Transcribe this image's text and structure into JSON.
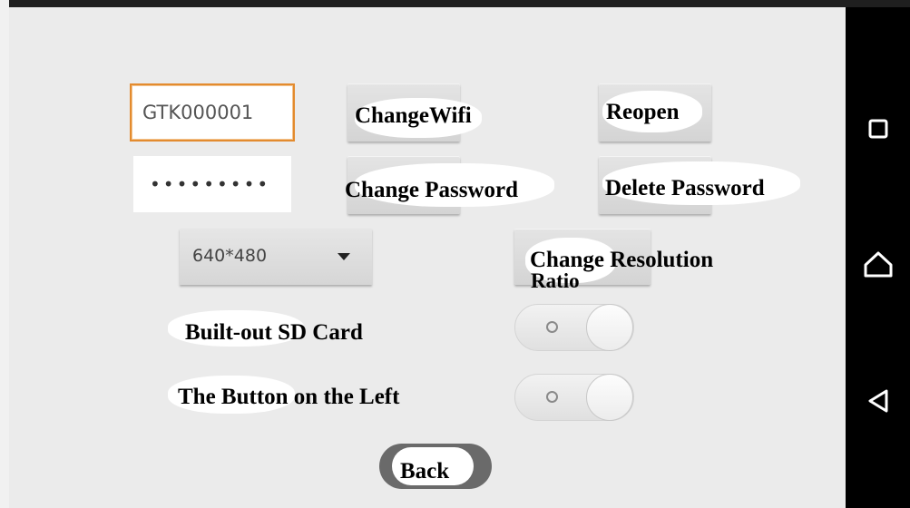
{
  "wifi": {
    "ssid_value": "GTK000001",
    "password_value": "•••••••••",
    "change_wifi_label": "ChangeWifi",
    "reopen_label": "Reopen",
    "change_password_label": "Change Password",
    "delete_password_label": "Delete Password"
  },
  "resolution": {
    "selected": "640*480",
    "change_label_line1": "Change Resolution",
    "change_label_line2": "Ratio"
  },
  "settings": {
    "sd_card_label": "Built-out SD Card",
    "sd_card_enabled": false,
    "button_left_label": "The Button on the Left",
    "button_left_enabled": false
  },
  "back_label": "Back",
  "navigation": {
    "icons": [
      "recent-apps-icon",
      "home-icon",
      "back-icon"
    ]
  }
}
